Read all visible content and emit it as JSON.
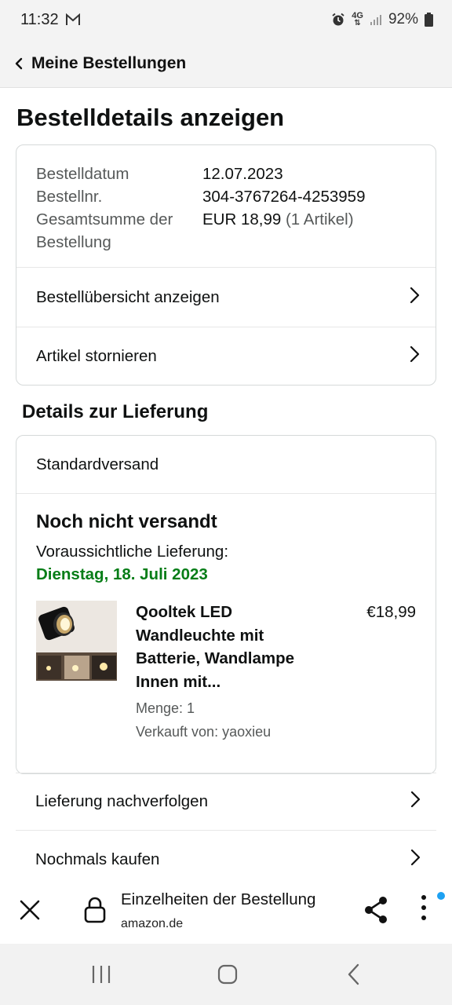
{
  "status_bar": {
    "time": "11:32",
    "mail_icon": "gmail-icon",
    "alarm_icon": "alarm-icon",
    "network": "4G",
    "signal_icon": "signal-icon",
    "battery": "92%"
  },
  "header": {
    "back_icon": "chevron-left-icon",
    "title": "Meine Bestellungen"
  },
  "page_title": "Bestelldetails anzeigen",
  "order_summary": {
    "rows": [
      {
        "label": "Bestelldatum",
        "value": "12.07.2023"
      },
      {
        "label": "Bestellnr.",
        "value": "304-3767264-4253959"
      },
      {
        "label": "Gesamtsumme der Bestellung",
        "value": "EUR 18,99",
        "extra": "(1 Artikel)"
      }
    ],
    "links": [
      {
        "label": "Bestellübersicht anzeigen"
      },
      {
        "label": "Artikel stornieren"
      }
    ]
  },
  "delivery": {
    "section_title": "Details zur Lieferung",
    "shipping_method": "Standardversand",
    "status": "Noch nicht versandt",
    "estimated_label": "Voraussichtliche Lieferung:",
    "estimated_date": "Dienstag, 18. Juli 2023",
    "item": {
      "title": "Qooltek LED Wandleuchte mit Batterie, Wandlampe Innen mit...",
      "price": "€18,99",
      "quantity": "Menge: 1",
      "seller": "Verkauft von: yaoxieu"
    }
  },
  "actions": [
    {
      "label": "Lieferung nachverfolgen"
    },
    {
      "label": "Nochmals kaufen"
    }
  ],
  "browser_bar": {
    "title": "Einzelheiten der Bestellung",
    "domain": "amazon.de"
  },
  "colors": {
    "delivery_date": "#067d17",
    "notification_dot": "#1da1f2",
    "header_bg": "#f3f3f3"
  }
}
